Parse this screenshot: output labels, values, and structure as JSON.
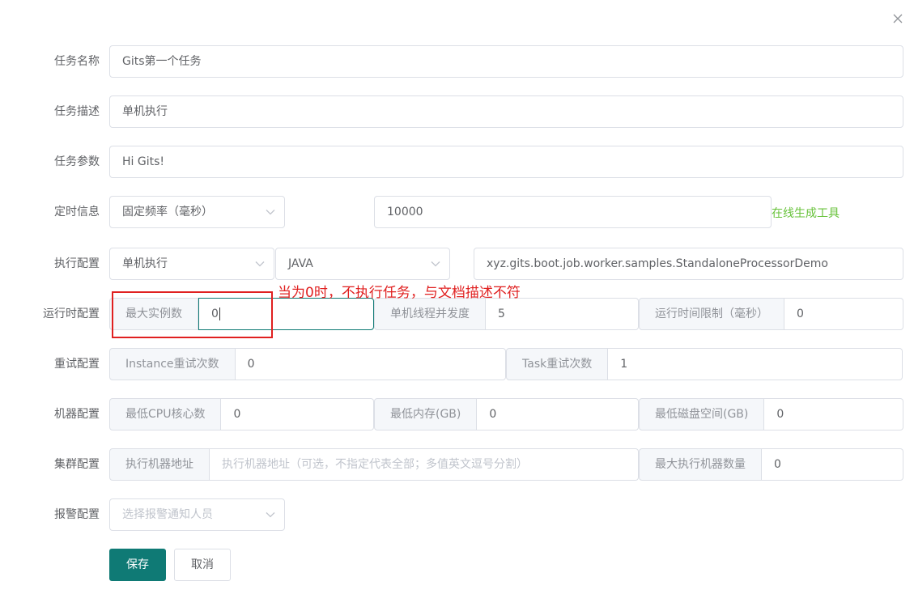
{
  "dialog": {
    "close_glyph": "×",
    "close_icon": "close-icon"
  },
  "form": {
    "task_name": {
      "label": "任务名称",
      "value": "Gits第一个任务"
    },
    "task_desc": {
      "label": "任务描述",
      "value": "单机执行"
    },
    "task_params": {
      "label": "任务参数",
      "value": "Hi Gits!"
    },
    "schedule": {
      "label": "定时信息",
      "type_value": "固定频率（毫秒）",
      "expr_value": "10000",
      "tool_link": "在线生成工具"
    },
    "exec": {
      "label": "执行配置",
      "mode_value": "单机执行",
      "processor_type": "JAVA",
      "processor_info": "xyz.gits.boot.job.worker.samples.StandaloneProcessorDemo"
    },
    "runtime": {
      "label": "运行时配置",
      "max_instance_label": "最大实例数",
      "max_instance_value": "0",
      "concurrency_label": "单机线程并发度",
      "concurrency_value": "5",
      "time_limit_label": "运行时间限制（毫秒）",
      "time_limit_value": "0"
    },
    "retry": {
      "label": "重试配置",
      "instance_retry_label": "Instance重试次数",
      "instance_retry_value": "0",
      "task_retry_label": "Task重试次数",
      "task_retry_value": "1"
    },
    "machine": {
      "label": "机器配置",
      "min_cpu_label": "最低CPU核心数",
      "min_cpu_value": "0",
      "min_memory_label": "最低内存(GB)",
      "min_memory_value": "0",
      "min_disk_label": "最低磁盘空间(GB)",
      "min_disk_value": "0"
    },
    "cluster": {
      "label": "集群配置",
      "designated_label": "执行机器地址",
      "designated_placeholder": "执行机器地址（可选，不指定代表全部；多值英文逗号分割）",
      "max_workers_label": "最大执行机器数量",
      "max_workers_value": "0"
    },
    "alarm": {
      "label": "报警配置",
      "placeholder": "选择报警通知人员"
    },
    "buttons": {
      "save": "保存",
      "cancel": "取消"
    }
  },
  "annotation": {
    "text": "当为0时，不执行任务，与文档描述不符",
    "color": "#e02020"
  },
  "colors": {
    "primary": "#0f7a75",
    "link": "#67c23a",
    "border": "#dcdfe6",
    "prepend_bg": "#f5f7fa",
    "focus_border": "#0f7a75"
  }
}
